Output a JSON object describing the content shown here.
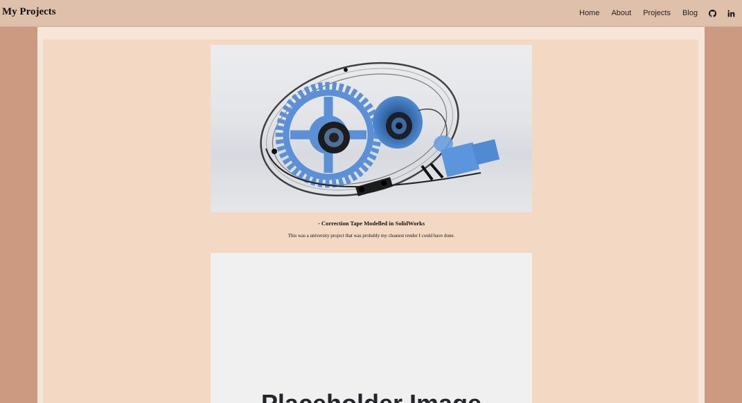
{
  "header": {
    "brand": "My Projects",
    "nav": [
      {
        "label": "Home"
      },
      {
        "label": "About"
      },
      {
        "label": "Projects"
      },
      {
        "label": "Blog"
      }
    ],
    "icons": [
      "github-icon",
      "linkedin-icon"
    ]
  },
  "projects": [
    {
      "title": "- Correction Tape Modelled in SolidWorks",
      "description": "This was a university project that was probably my cleanest render I could have done."
    }
  ],
  "placeholder": {
    "label": "Placeholder Image"
  },
  "colors": {
    "navbar": "#dfc0ab",
    "page_background": "#cc9a80",
    "content_outer": "#f6e6da",
    "content_panel": "#f3d8c3",
    "gear_blue": "#5b8fd6"
  }
}
